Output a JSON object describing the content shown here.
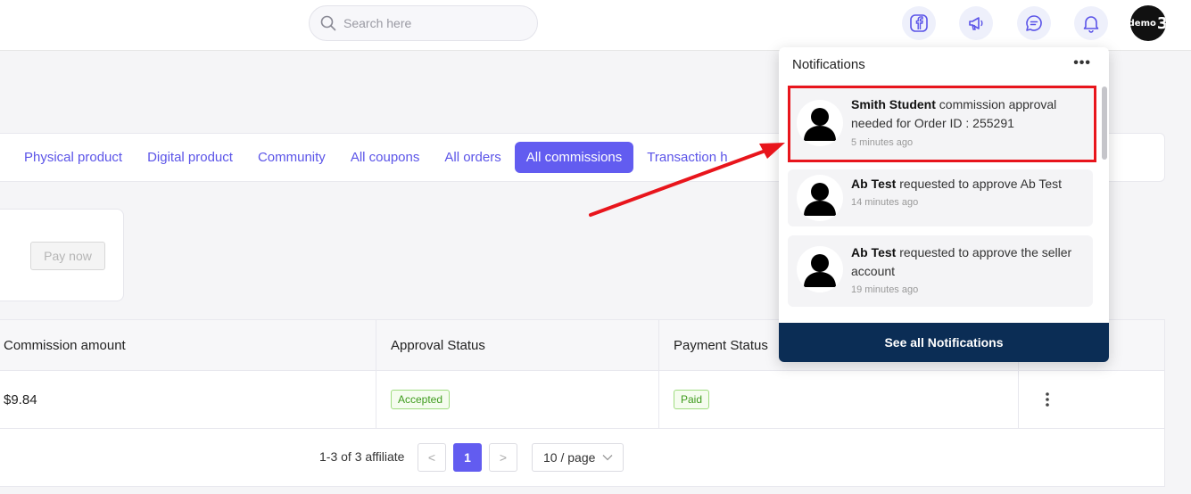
{
  "header": {
    "search_placeholder": "Search here",
    "icons": [
      "facebook-icon",
      "megaphone-icon",
      "chat-icon",
      "bell-icon"
    ],
    "avatar_text": "demo",
    "avatar_number": "3"
  },
  "tabs": [
    {
      "label": "Physical product",
      "active": false
    },
    {
      "label": "Digital product",
      "active": false
    },
    {
      "label": "Community",
      "active": false
    },
    {
      "label": "All coupons",
      "active": false
    },
    {
      "label": "All orders",
      "active": false
    },
    {
      "label": "All commissions",
      "active": true
    },
    {
      "label": "Transaction h",
      "active": false
    }
  ],
  "card": {
    "pay_now_label": "Pay now"
  },
  "table": {
    "headers": {
      "commission": "Commission amount",
      "approval": "Approval Status",
      "payment": "Payment Status"
    },
    "rows": [
      {
        "commission": "$9.84",
        "approval": "Accepted",
        "payment": "Paid"
      }
    ]
  },
  "pagination": {
    "info": "1-3 of 3 affiliate",
    "prev": "<",
    "current_page": "1",
    "next": ">",
    "page_size": "10 / page"
  },
  "notifications": {
    "title": "Notifications",
    "more": "•••",
    "items": [
      {
        "name": "Smith Student",
        "text": "commission approval needed for Order ID : 255291",
        "time": "5 minutes ago"
      },
      {
        "name": "Ab Test",
        "text": "requested to approve Ab Test",
        "time": "14 minutes ago"
      },
      {
        "name": "Ab Test",
        "text": "requested to approve the seller account",
        "time": "19 minutes ago"
      }
    ],
    "footer": "See all Notifications"
  },
  "colors": {
    "accent": "#625cf0",
    "footer": "#0b2d55",
    "highlight": "#e8151c",
    "success": "#3e9b1c"
  }
}
